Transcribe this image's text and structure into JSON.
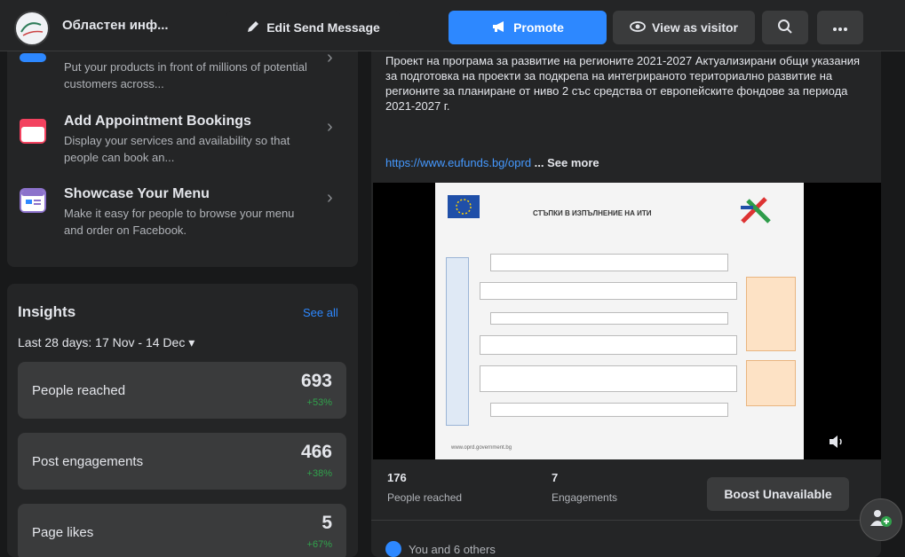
{
  "header": {
    "page_name": "Областен инф...",
    "edit_label": "Edit Send Message",
    "promote_label": "Promote",
    "visitor_label": "View as visitor"
  },
  "features": [
    {
      "title": "",
      "desc": "Put your products in front of millions of potential customers across...",
      "icon_color": "#2d88ff"
    },
    {
      "title": "Add Appointment Bookings",
      "desc": "Display your services and availability so that people can book an...",
      "icon_color": "#f3425f"
    },
    {
      "title": "Showcase Your Menu",
      "desc": "Make it easy for people to browse your menu and order on Facebook.",
      "icon_color": "#8c72cb"
    }
  ],
  "insights": {
    "title": "Insights",
    "see_all": "See all",
    "date_range": "Last 28 days: 17 Nov - 14 Dec",
    "metrics": [
      {
        "label": "People reached",
        "value": "693",
        "change": "+53%"
      },
      {
        "label": "Post engagements",
        "value": "466",
        "change": "+38%"
      },
      {
        "label": "Page likes",
        "value": "5",
        "change": "+67%"
      }
    ]
  },
  "post": {
    "text": "Проект на програма за развитие на регионите 2021-2027 Актуализирани общи указания за подготовка на проекти за подкрепа на интегрираното териториално развитие на регионите за планиране от ниво 2 със средства от европейските фондове за периода 2021-2027 г.",
    "link": "https://www.eufunds.bg/oprd",
    "see_more": "... See more",
    "slide_title": "СТЪПКИ В ИЗПЪЛНЕНИЕ НА ИТИ",
    "slide_footer": "www.oprd.government.bg",
    "stats": {
      "reached_value": "176",
      "reached_label": "People reached",
      "engagements_value": "7",
      "engagements_label": "Engagements"
    },
    "boost_label": "Boost Unavailable",
    "reactions_text": "You and 6 others"
  },
  "colors": {
    "accent": "#2d88ff",
    "positive": "#31a24c",
    "background": "#18191a",
    "card": "#242526"
  }
}
